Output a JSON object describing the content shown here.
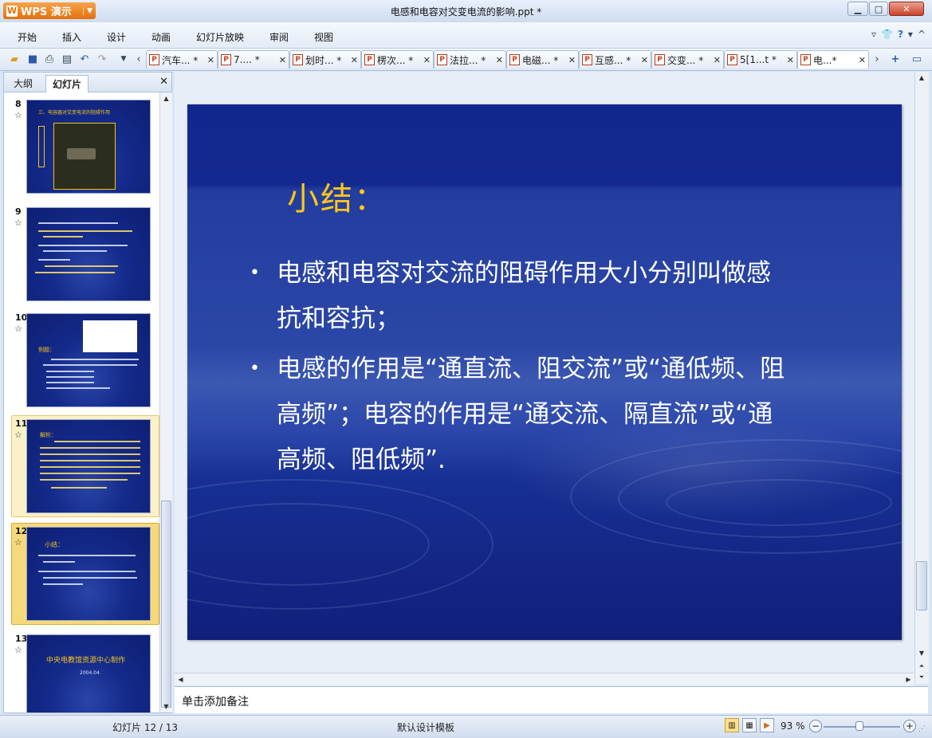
{
  "app": {
    "name": "WPS 演示",
    "window_title": "电感和电容对交变电流的影响.ppt *"
  },
  "menu": [
    "开始",
    "插入",
    "设计",
    "动画",
    "幻灯片放映",
    "审阅",
    "视图"
  ],
  "doc_tabs": [
    "汽车... *",
    "7.... *",
    "划时... *",
    "楞次... *",
    "法拉... *",
    "电磁... *",
    "互感... *",
    "交变... *",
    "5[1...t *",
    "电...*"
  ],
  "panel": {
    "tabs": [
      "大纲",
      "幻灯片"
    ],
    "active_tab": "幻灯片"
  },
  "thumbnails": [
    {
      "num": "8",
      "title": "三、电容器对交变电流的阻碍作用"
    },
    {
      "num": "9",
      "title": ""
    },
    {
      "num": "10",
      "title": "例题："
    },
    {
      "num": "11",
      "title": "解析："
    },
    {
      "num": "12",
      "title": "小结："
    },
    {
      "num": "13",
      "title": "中央电教馆资源中心制作",
      "subtitle": "2004.04"
    }
  ],
  "slide": {
    "heading": "小结：",
    "bullets": [
      [
        "电感和电容对交流的阻碍作用大小分别叫做感",
        "抗和容抗；"
      ],
      [
        "电感的作用是“通直流、阻交流”或“通低频、阻",
        "高频”；电容的作用是“通交流、隔直流”或“通",
        "高频、阻低频”."
      ]
    ]
  },
  "notes_placeholder": "单击添加备注",
  "status": {
    "slide_counter": "幻灯片 12 / 13",
    "template": "默认设计模板",
    "zoom": "93 %",
    "zoom_percent": 93
  },
  "colors": {
    "heading": "#ffc61a",
    "slide_bg": "#14298f",
    "accent_orange": "#e3700b"
  }
}
